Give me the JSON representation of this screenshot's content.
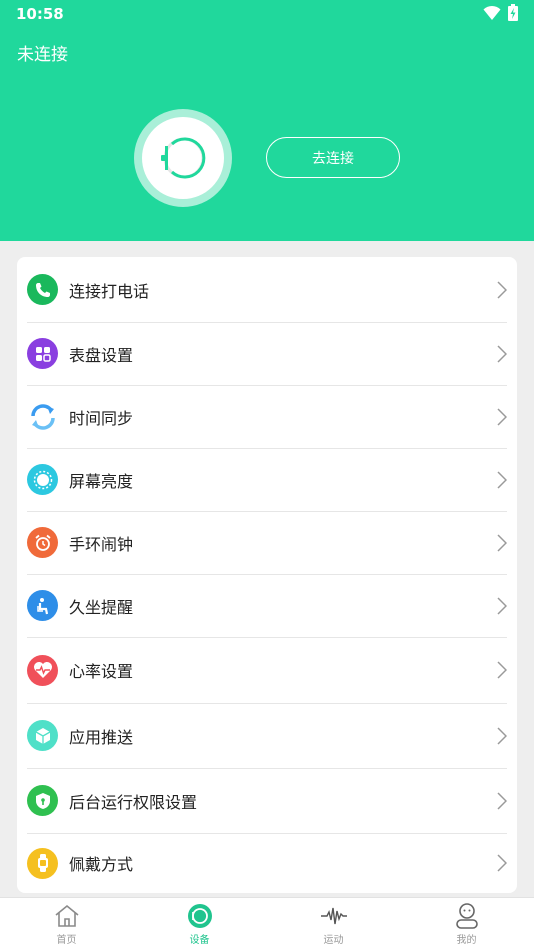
{
  "status_bar": {
    "time": "10:58"
  },
  "header": {
    "connection_status": "未连接",
    "connect_button": "去连接",
    "bg_color": "#20d89c"
  },
  "menu": [
    {
      "label": "连接打电话",
      "icon": "phone-icon",
      "color": "#1ab85c"
    },
    {
      "label": "表盘设置",
      "icon": "dial-icon",
      "color": "#8a3fe0"
    },
    {
      "label": "时间同步",
      "icon": "sync-icon",
      "color": "#3b9cf0"
    },
    {
      "label": "屏幕亮度",
      "icon": "brightness-icon",
      "color": "#2cc8e0"
    },
    {
      "label": "手环闹钟",
      "icon": "alarm-icon",
      "color": "#f06a3a"
    },
    {
      "label": "久坐提醒",
      "icon": "sedentary-icon",
      "color": "#2e8ee8"
    },
    {
      "label": "心率设置",
      "icon": "heart-rate-icon",
      "color": "#f0505a"
    },
    {
      "label": "应用推送",
      "icon": "app-push-icon",
      "color": "#4fe0c8"
    },
    {
      "label": "后台运行权限设置",
      "icon": "shield-icon",
      "color": "#2fc050"
    },
    {
      "label": "佩戴方式",
      "icon": "wear-icon",
      "color": "#f5c020"
    }
  ],
  "nav": {
    "home": "首页",
    "device": "设备",
    "sport": "运动",
    "mine": "我的",
    "active": "device",
    "active_color": "#20c48e"
  }
}
